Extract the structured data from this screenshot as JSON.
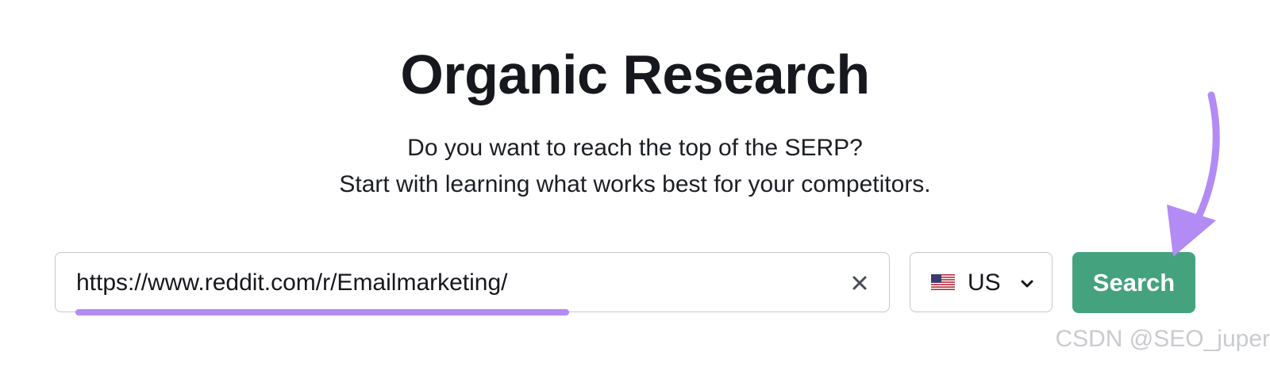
{
  "page": {
    "title": "Organic Research",
    "subtitle_line1": "Do you want to reach the top of the SERP?",
    "subtitle_line2": "Start with learning what works best for your competitors."
  },
  "search": {
    "value": "https://www.reddit.com/r/Emailmarketing/",
    "clear_icon": "close-icon"
  },
  "database": {
    "flag_icon": "us-flag-icon",
    "selected": "US",
    "chevron_icon": "chevron-down-icon"
  },
  "search_button": {
    "label": "Search"
  },
  "annotation": {
    "highlight_color": "#b38bf4",
    "arrow_color": "#b38bf4"
  },
  "colors": {
    "button": "#44a27f",
    "text": "#16181d",
    "border": "#c4c7cd"
  },
  "watermark": "CSDN @SEO_juper"
}
